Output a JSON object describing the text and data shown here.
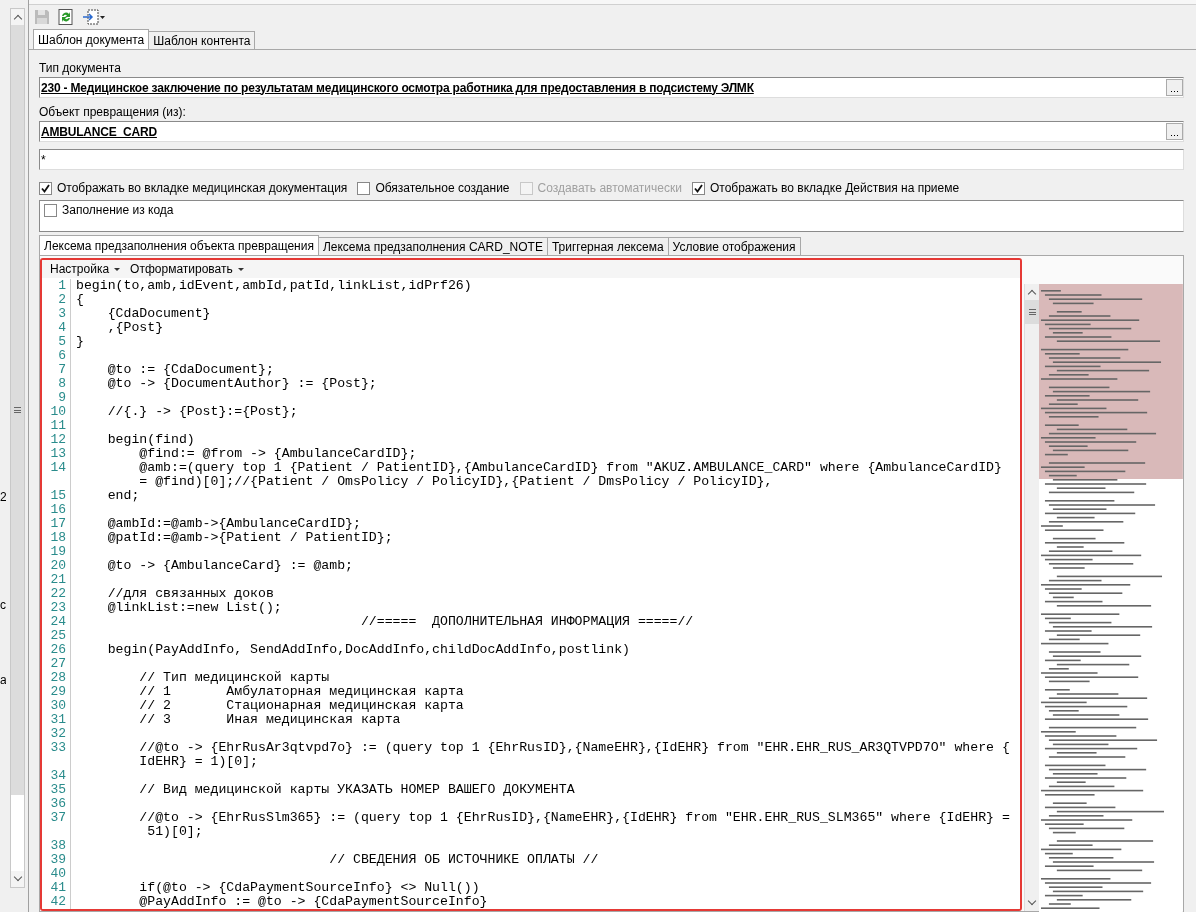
{
  "left_fragments": [
    "2",
    "c",
    "a"
  ],
  "tabs": [
    {
      "label": "Шаблон документа",
      "selected": true
    },
    {
      "label": "Шаблон контента",
      "selected": false
    }
  ],
  "fields": [
    {
      "label": "Тип документа",
      "value": "230 - Медицинское заключение по результатам медицинского осмотра работника для предоставления в подсистему ЭЛМК",
      "kind": "lookup"
    },
    {
      "label": "Объект превращения (из):",
      "value": "AMBULANCE_CARD",
      "kind": "lookup"
    },
    {
      "value": "*",
      "kind": "text"
    }
  ],
  "checkboxes": [
    {
      "label": "Отображать во вкладке медицинская документация",
      "checked": true,
      "disabled": false
    },
    {
      "label": "Обязательное создание",
      "checked": false,
      "disabled": false
    },
    {
      "label": "Создавать автоматически",
      "checked": false,
      "disabled": true
    },
    {
      "label": "Отображать во вкладке Действия на приеме",
      "checked": true,
      "disabled": false
    }
  ],
  "fill_option": {
    "label": "Заполнение из кода",
    "checked": false
  },
  "lexeme_tabs": [
    {
      "label": "Лексема предзаполнения объекта превращения",
      "selected": true
    },
    {
      "label": "Лексема предзаполнения CARD_NOTE",
      "selected": false
    },
    {
      "label": "Триггерная лексема",
      "selected": false
    },
    {
      "label": "Условие отображения",
      "selected": false
    }
  ],
  "editor": {
    "menus": [
      "Настройка",
      "Отформатировать"
    ],
    "lines": [
      {
        "n": "1",
        "text": "begin(to,amb,idEvent,ambId,patId,linkList,idPrf26)"
      },
      {
        "n": "2",
        "text": "{"
      },
      {
        "n": "3",
        "text": "    {CdaDocument}"
      },
      {
        "n": "4",
        "text": "    ,{Post}"
      },
      {
        "n": "5",
        "text": "}"
      },
      {
        "n": "6"
      },
      {
        "n": "7",
        "text": "    @to := {CdaDocument};"
      },
      {
        "n": "8",
        "text": "    @to -> {DocumentAuthor} := {Post};"
      },
      {
        "n": "9"
      },
      {
        "n": "10",
        "text": "    //{.} -> {Post}:={Post};"
      },
      {
        "n": "11"
      },
      {
        "n": "12",
        "text": "    begin(find)"
      },
      {
        "n": "13",
        "text": "        @find:= @from -> {AmbulanceCardID};"
      },
      {
        "n": "14",
        "text": "        @amb:=(query top 1 {Patient / PatientID},{AmbulanceCardID} from \"AKUZ.AMBULANCE_CARD\" where {AmbulanceCardID}",
        "cont": "        = @find)[0];//{Patient / OmsPolicy / PolicyID},{Patient / DmsPolicy / PolicyID},"
      },
      {
        "n": "15",
        "text": "    end;"
      },
      {
        "n": "16"
      },
      {
        "n": "17",
        "text": "    @ambId:=@amb->{AmbulanceCardID};"
      },
      {
        "n": "18",
        "text": "    @patId:=@amb->{Patient / PatientID};"
      },
      {
        "n": "19"
      },
      {
        "n": "20",
        "text": "    @to -> {AmbulanceCard} := @amb;"
      },
      {
        "n": "21"
      },
      {
        "n": "22",
        "text": "    //для связанных доков"
      },
      {
        "n": "23",
        "text": "    @linkList:=new List();"
      },
      {
        "n": "24",
        "text": "                                    //=====  ДОПОЛНИТЕЛЬНАЯ ИНФОРМАЦИЯ =====//"
      },
      {
        "n": "25"
      },
      {
        "n": "26",
        "text": "    begin(PayAddInfo, SendAddInfo,DocAddInfo,childDocAddInfo,postlink)"
      },
      {
        "n": "27"
      },
      {
        "n": "28",
        "text": "        // Тип медицинской карты"
      },
      {
        "n": "29",
        "text": "        // 1       Амбулаторная медицинская карта"
      },
      {
        "n": "30",
        "text": "        // 2       Стационарная медицинская карта"
      },
      {
        "n": "31",
        "text": "        // 3       Иная медицинская карта"
      },
      {
        "n": "32"
      },
      {
        "n": "33",
        "text": "        //@to -> {EhrRusAr3qtvpd7o} := (query top 1 {EhrRusID},{NameEHR},{IdEHR} from \"EHR.EHR_RUS_AR3QTVPD7O\" where {",
        "cont": "        IdEHR} = 1)[0];"
      },
      {
        "n": "34"
      },
      {
        "n": "35",
        "text": "        // Вид медицинской карты УКАЗАТЬ НОМЕР ВАШЕГО ДОКУМЕНТА"
      },
      {
        "n": "36"
      },
      {
        "n": "37",
        "text": "        //@to -> {EhrRusSlm365} := (query top 1 {EhrRusID},{NameEHR},{IdEHR} from \"EHR.EHR_RUS_SLM365\" where {IdEHR} =",
        "cont": "         51)[0];"
      },
      {
        "n": "38"
      },
      {
        "n": "39",
        "text": "                                // СВЕДЕНИЯ ОБ ИСТОЧНИКЕ ОПЛАТЫ //"
      },
      {
        "n": "40"
      },
      {
        "n": "41",
        "text": "        if(@to -> {CdaPaymentSourceInfo} <> Null())"
      },
      {
        "n": "42",
        "text": "        @PayAddInfo := @to -> {CdaPaymentSourceInfo}"
      }
    ]
  }
}
